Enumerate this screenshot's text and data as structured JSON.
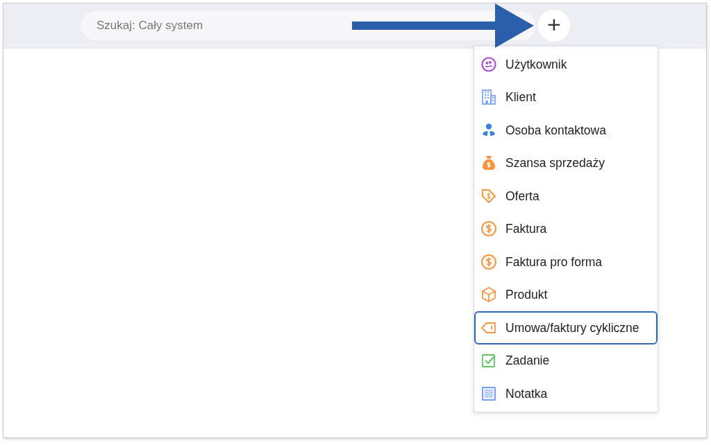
{
  "search": {
    "placeholder": "Szukaj: Cały system"
  },
  "add_button": {
    "label": "+"
  },
  "menu": {
    "items": [
      {
        "label": "Użytkownik",
        "kind": "user",
        "selected": false
      },
      {
        "label": "Klient",
        "kind": "building",
        "selected": false
      },
      {
        "label": "Osoba kontaktowa",
        "kind": "person",
        "selected": false
      },
      {
        "label": "Szansa sprzedaży",
        "kind": "moneybag",
        "selected": false
      },
      {
        "label": "Oferta",
        "kind": "tag",
        "selected": false
      },
      {
        "label": "Faktura",
        "kind": "dollar",
        "selected": false
      },
      {
        "label": "Faktura pro forma",
        "kind": "dollar",
        "selected": false
      },
      {
        "label": "Produkt",
        "kind": "box",
        "selected": false
      },
      {
        "label": "Umowa/faktury cykliczne",
        "kind": "label",
        "selected": true
      },
      {
        "label": "Zadanie",
        "kind": "check",
        "selected": false
      },
      {
        "label": "Notatka",
        "kind": "note",
        "selected": false
      }
    ]
  }
}
